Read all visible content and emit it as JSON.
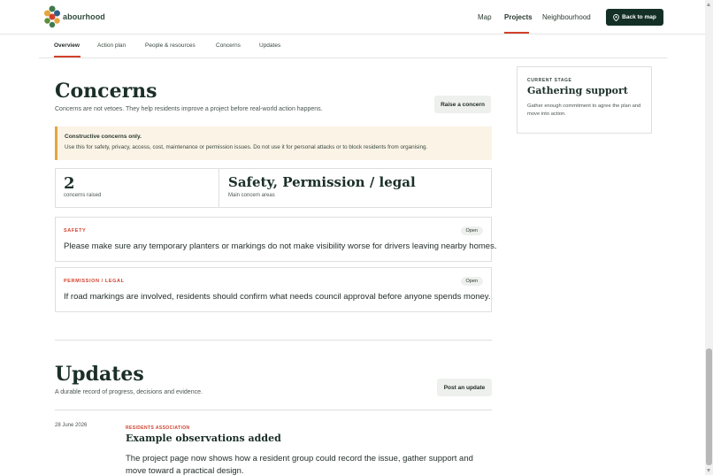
{
  "brand": {
    "name": "Neighbourhood",
    "logo_text": "abourhood"
  },
  "nav": {
    "items": [
      {
        "label": "Map"
      },
      {
        "label": "Projects"
      },
      {
        "label": "Neighbourhood"
      }
    ],
    "back_button": "Back to map"
  },
  "tabs": [
    {
      "label": "Overview"
    },
    {
      "label": "Action plan"
    },
    {
      "label": "People & resources"
    },
    {
      "label": "Concerns"
    },
    {
      "label": "Updates"
    }
  ],
  "concerns": {
    "title": "Concerns",
    "subtitle": "Concerns are not vetoes. They help residents improve a project before real-world action happens.",
    "raise_button": "Raise a concern",
    "notice_title": "Constructive concerns only.",
    "notice_text": "Use this for safety, privacy, access, cost, maintenance or permission issues. Do not use it for personal attacks or to block residents from organising.",
    "stats": {
      "count": "2",
      "count_label": "concerns raised",
      "main_area": "Safety, Permission / legal",
      "main_area_label": "Main concern areas"
    },
    "items": [
      {
        "category": "SAFETY",
        "status": "Open",
        "text": "Please make sure any temporary planters or markings do not make visibility worse for drivers leaving nearby homes."
      },
      {
        "category": "PERMISSION / LEGAL",
        "status": "Open",
        "text": "If road markings are involved, residents should confirm what needs council approval before anyone spends money."
      }
    ]
  },
  "updates": {
    "title": "Updates",
    "subtitle": "A durable record of progress, decisions and evidence.",
    "post_button": "Post an update",
    "entries": [
      {
        "date": "28 June 2026",
        "category": "RESIDENTS ASSOCIATION",
        "title": "Example observations added",
        "body": "The project page now shows how a resident group could record the issue, gather support and move toward a practical design."
      }
    ]
  },
  "stage": {
    "kicker": "CURRENT STAGE",
    "title": "Gathering support",
    "description": "Gather enough commitment to agree the plan and move into action."
  },
  "colors": {
    "accent": "#d1402c",
    "dark": "#143026",
    "notice": "#fbf3e6",
    "notice_border": "#e5a53c"
  },
  "icons": {
    "logo": "leaf-cluster-logo",
    "pin": "map-pin-icon"
  }
}
